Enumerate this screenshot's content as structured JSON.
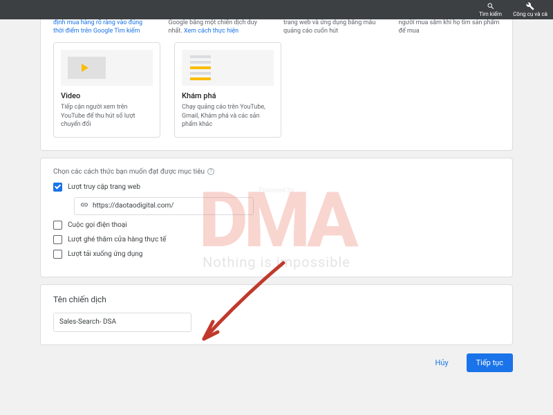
{
  "topbar": {
    "search_label": "Tìm kiếm",
    "tools_label": "Công cụ và cà"
  },
  "types": {
    "row1": [
      "định mua hàng rõ ràng vào đúng thời điểm trên Google Tìm kiếm",
      "Google bằng một chiến dịch duy nhất.",
      "trang web và ứng dụng bằng mẫu quảng cáo cuốn hút",
      "người mua sắm khi họ tìm sản phẩm để mua"
    ],
    "row1_linktext": "Xem cách thực hiện",
    "tiles": [
      {
        "title": "Video",
        "desc": "Tiếp cận người xem trên YouTube để thu hút số lượt chuyển đổi"
      },
      {
        "title": "Khám phá",
        "desc": "Chạy quảng cáo trên YouTube, Gmail, Khám phá và các sản phẩm khác"
      }
    ]
  },
  "goals": {
    "heading": "Chọn các cách thức bạn muốn đạt được mục tiêu",
    "website_label": "Lượt truy cập trang web",
    "url_value": "https://daotaodigital.com/",
    "phone_label": "Cuộc gọi điện thoại",
    "store_label": "Lượt ghé thăm cửa hàng thực tế",
    "app_label": "Lượt tải xuống ứng dụng"
  },
  "campaign_name": {
    "title": "Tên chiến dịch",
    "value": "Sales-Search- DSA"
  },
  "footer": {
    "cancel": "Hủy",
    "continue": "Tiếp tục"
  },
  "watermark": {
    "powered": "Powered by",
    "logo": "DMA",
    "tagline": "Nothing is impossible"
  }
}
